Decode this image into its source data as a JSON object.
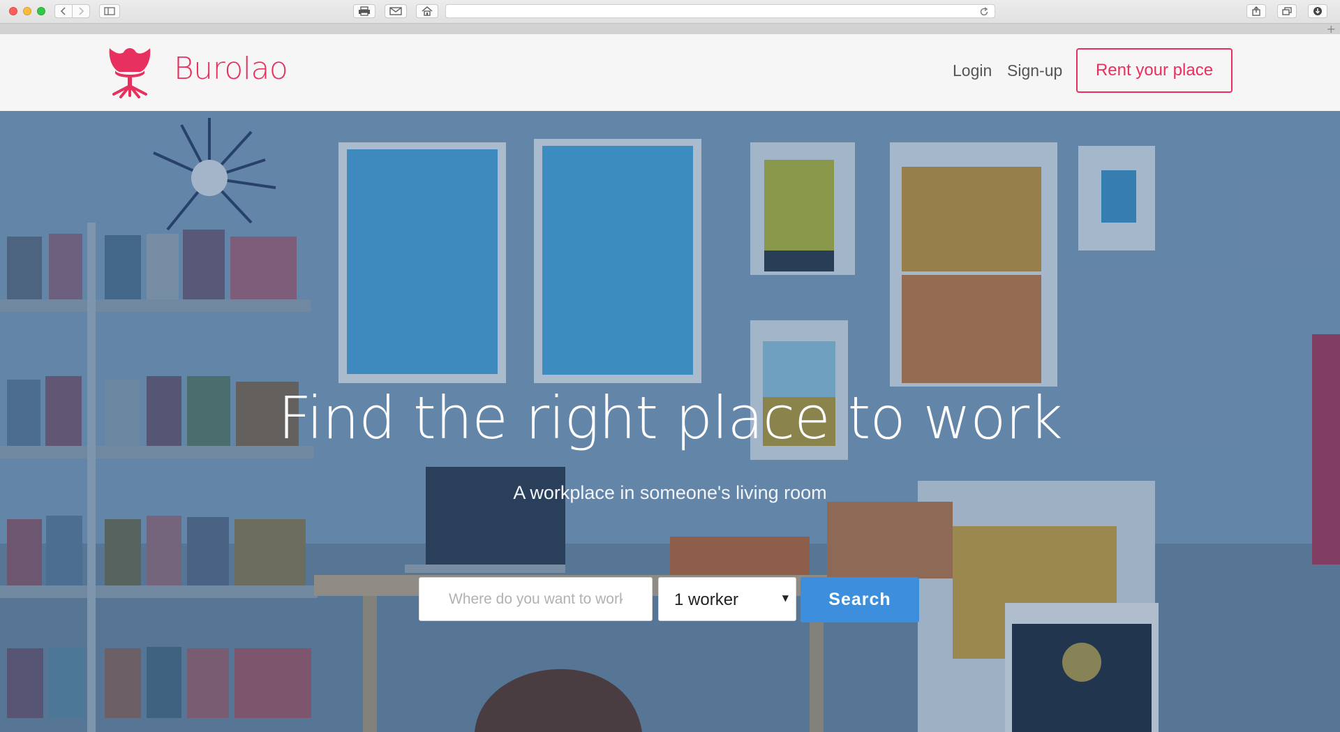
{
  "browser": {
    "icons": [
      "back-icon",
      "forward-icon",
      "sidebar-icon",
      "print-icon",
      "mail-icon",
      "home-icon",
      "reload-icon",
      "share-icon",
      "tabs-icon",
      "download-icon",
      "new-tab-icon"
    ],
    "new_tab_glyph": "+"
  },
  "header": {
    "brand": "Burolao",
    "login": "Login",
    "signup": "Sign-up",
    "rent_cta": "Rent your place"
  },
  "hero": {
    "title": "Find the right place to work",
    "subtitle": "A workplace in someone's living room",
    "search": {
      "where_placeholder": "Where do you want to work",
      "where_value": "",
      "workers_selected": "1 worker",
      "button": "Search"
    }
  },
  "colors": {
    "brand": "#e8305e",
    "search_button": "#3d8fde",
    "header_bg": "#f6f6f6"
  }
}
